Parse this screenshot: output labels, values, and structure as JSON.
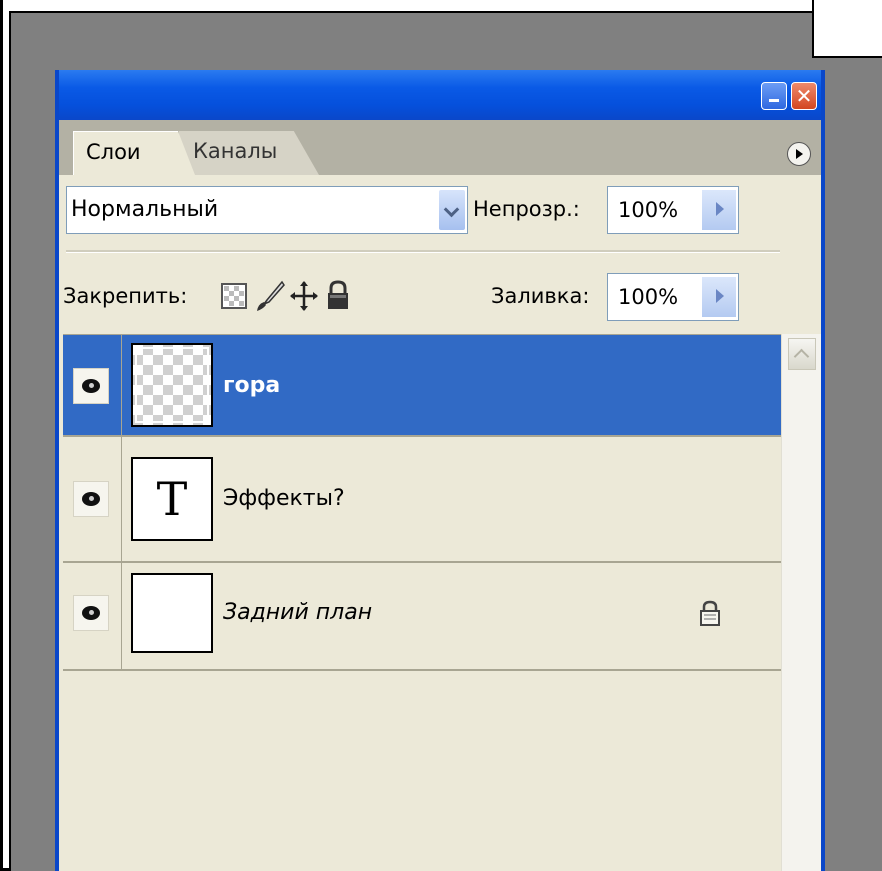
{
  "tabs": [
    {
      "label": "Слои",
      "active": true
    },
    {
      "label": "Каналы",
      "active": false
    }
  ],
  "blend_mode": {
    "value": "Нормальный"
  },
  "opacity": {
    "label": "Непрозр.:",
    "value": "100%"
  },
  "lock": {
    "label": "Закрепить:",
    "icons": [
      "lock-transparent-pixels-icon",
      "lock-image-pixels-icon",
      "lock-position-icon",
      "lock-all-icon"
    ]
  },
  "fill": {
    "label": "Заливка:",
    "value": "100%"
  },
  "layers": [
    {
      "name": "гора",
      "thumb": "transparent-checker",
      "visible": true,
      "selected": true,
      "locked": false
    },
    {
      "name": "Эффекты?",
      "thumb": "text-layer",
      "thumb_glyph": "T",
      "visible": true,
      "selected": false,
      "locked": false
    },
    {
      "name": "Задний план",
      "thumb": "white",
      "visible": true,
      "selected": false,
      "locked": true
    }
  ],
  "colors": {
    "titlebar": "#0a5ae6",
    "selected_row": "#316ac5",
    "panel_bg": "#ece9d8",
    "outside_bg": "#808080"
  },
  "title_buttons": {
    "close_glyph": "✕"
  }
}
